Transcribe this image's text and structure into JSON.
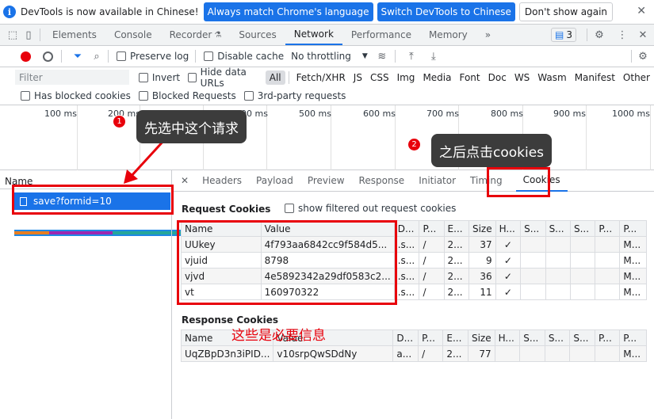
{
  "infobar": {
    "message": "DevTools is now available in Chinese!",
    "btn_match": "Always match Chrome's language",
    "btn_switch": "Switch DevTools to Chinese",
    "btn_dont_show": "Don't show again"
  },
  "tabs": [
    "Elements",
    "Console",
    "Recorder",
    "Sources",
    "Network",
    "Performance",
    "Memory"
  ],
  "active_tab": "Network",
  "issues_count": "3",
  "toolbar": {
    "preserve_log": "Preserve log",
    "disable_cache": "Disable cache",
    "throttling": "No throttling"
  },
  "filter": {
    "placeholder": "Filter",
    "invert": "Invert",
    "hide_data_urls": "Hide data URLs",
    "types": [
      "All",
      "Fetch/XHR",
      "JS",
      "CSS",
      "Img",
      "Media",
      "Font",
      "Doc",
      "WS",
      "Wasm",
      "Manifest",
      "Other"
    ],
    "has_blocked_cookies": "Has blocked cookies",
    "blocked_requests": "Blocked Requests",
    "third_party": "3rd-party requests"
  },
  "timeline": {
    "ticks": [
      "100 ms",
      "200 ms",
      "300 ms",
      "400 ms",
      "500 ms",
      "600 ms",
      "700 ms",
      "800 ms",
      "900 ms",
      "1000 ms"
    ]
  },
  "request_list": {
    "header": "Name",
    "selected": "save?formid=10"
  },
  "detail_tabs": [
    "Headers",
    "Payload",
    "Preview",
    "Response",
    "Initiator",
    "Timing",
    "Cookies"
  ],
  "active_detail_tab": "Cookies",
  "request_cookies": {
    "title": "Request Cookies",
    "show_filtered": "show filtered out request cookies",
    "columns": [
      "Name",
      "Value",
      "D...",
      "P...",
      "E...",
      "Size",
      "H...",
      "S...",
      "S...",
      "S...",
      "P...",
      "P..."
    ],
    "rows": [
      [
        "UUkey",
        "4f793aa6842cc9f584d5...",
        ".s...",
        "/",
        "2...",
        "37",
        "✓",
        "",
        "",
        "",
        "",
        "M..."
      ],
      [
        "vjuid",
        "8798",
        ".s...",
        "/",
        "2...",
        "9",
        "✓",
        "",
        "",
        "",
        "",
        "M..."
      ],
      [
        "vjvd",
        "4e5892342a29df0583c2...",
        ".s...",
        "/",
        "2...",
        "36",
        "✓",
        "",
        "",
        "",
        "",
        "M..."
      ],
      [
        "vt",
        "160970322",
        ".s...",
        "/",
        "2...",
        "11",
        "✓",
        "",
        "",
        "",
        "",
        "M..."
      ]
    ]
  },
  "response_cookies": {
    "title": "Response Cookies",
    "columns": [
      "Name",
      "Value",
      "D...",
      "P...",
      "E...",
      "Size",
      "H...",
      "S...",
      "S...",
      "S...",
      "P...",
      "P..."
    ],
    "rows": [
      [
        "UqZBpD3n3iPID...",
        "v10srpQwSDdNy",
        "a...",
        "/",
        "2...",
        "77",
        "",
        "",
        "",
        "",
        "",
        "M..."
      ]
    ]
  },
  "annotations": {
    "step1_num": "1",
    "step1_text": "先选中这个请求",
    "step2_num": "2",
    "step2_text": "之后点击cookies",
    "note": "这些是必要信息"
  },
  "colors": {
    "accent": "#1a73e8",
    "annotation_red": "#e8000b",
    "bubble": "#3c3c3c"
  }
}
